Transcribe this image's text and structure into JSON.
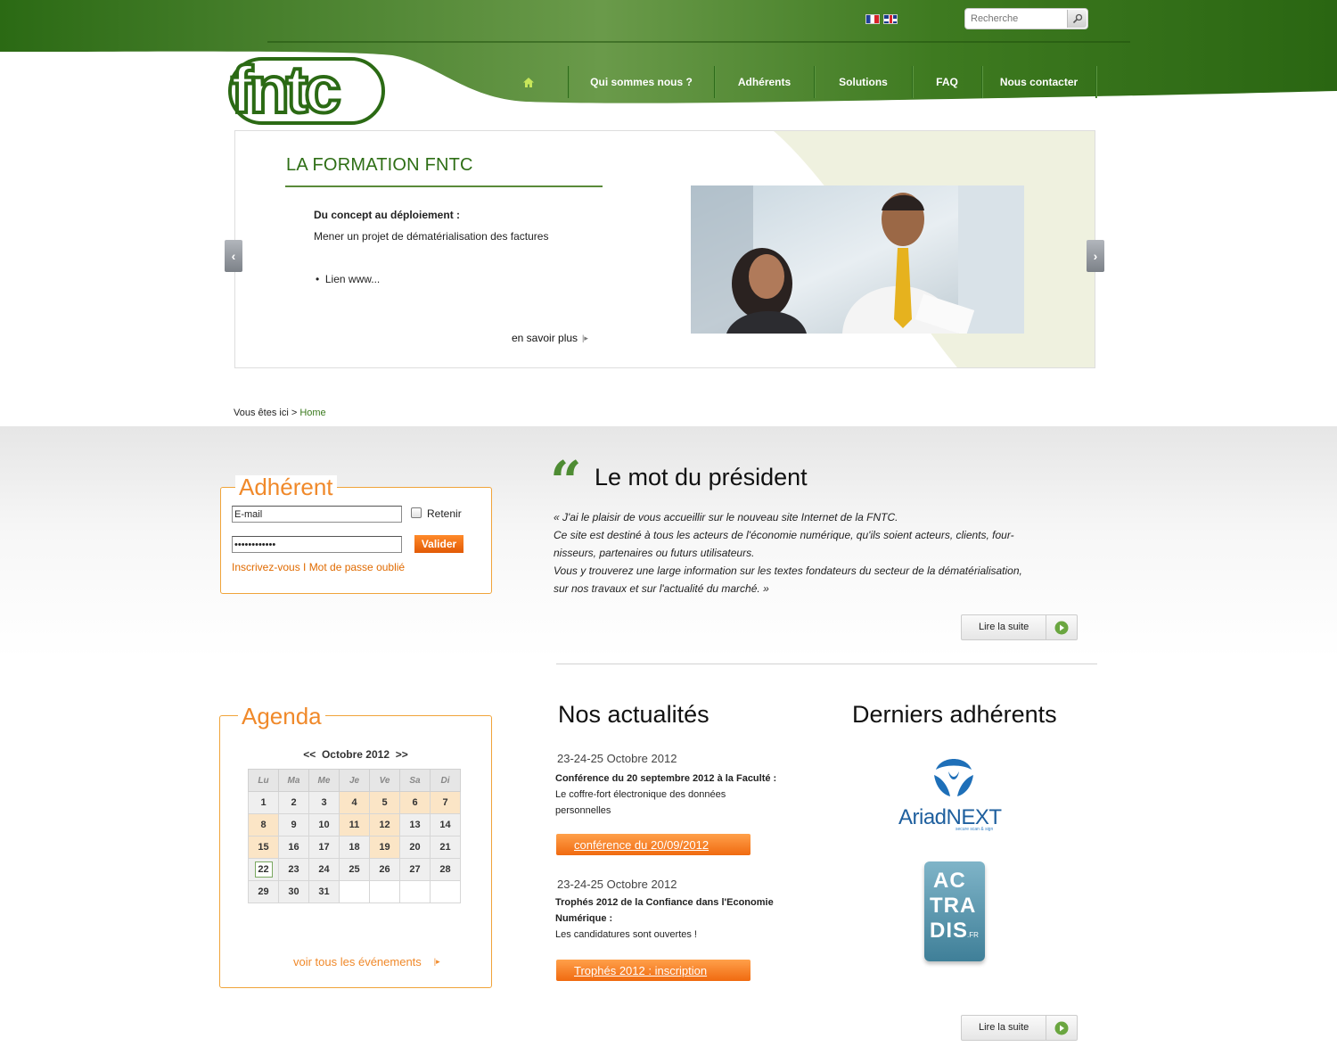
{
  "header": {
    "search": {
      "placeholder": "Recherche"
    },
    "logo_text": "fntc",
    "nav": [
      {
        "label": ""
      },
      {
        "label": "Qui sommes nous ?"
      },
      {
        "label": "Adhérents"
      },
      {
        "label": "Solutions"
      },
      {
        "label": "FAQ"
      },
      {
        "label": "Nous contacter"
      }
    ]
  },
  "slider": {
    "title": "LA FORMATION FNTC",
    "subtitle": "Du concept au déploiement :",
    "text": "Mener un projet de dématérialisation des factures",
    "bullet": "Lien www...",
    "more": "en savoir plus",
    "prev": "‹",
    "next": "›"
  },
  "breadcrumb": {
    "prefix": "Vous êtes ici >",
    "current": "Home"
  },
  "adherent": {
    "title": "Adhérent",
    "email_value": "E-mail",
    "password_value": "••••••••••••",
    "remember_label": "Retenir",
    "submit_label": "Valider",
    "links": "Inscrivez-vous I Mot de passe oublié"
  },
  "president": {
    "title": "Le mot du président",
    "paragraph": [
      "« J'ai le plaisir de vous accueillir sur le nouveau site Internet de la FNTC.",
      "Ce site est destiné à tous les acteurs de l'économie numérique, qu'ils soient acteurs, clients,  four-",
      "nisseurs, partenaires ou futurs utilisateurs.",
      "Vous y trouverez une large information sur les textes fondateurs du secteur de la dématérialisation,",
      "sur nos travaux et sur l'actualité du marché. »"
    ],
    "more_label": "Lire la suite"
  },
  "agenda": {
    "title": "Agenda",
    "prev": "<<",
    "month": "Octobre 2012",
    "next": ">>",
    "days": [
      "Lu",
      "Ma",
      "Me",
      "Je",
      "Ve",
      "Sa",
      "Di"
    ],
    "weeks": [
      [
        "1",
        "2",
        "3",
        "4",
        "5",
        "6",
        "7"
      ],
      [
        "8",
        "9",
        "10",
        "11",
        "12",
        "13",
        "14"
      ],
      [
        "15",
        "16",
        "17",
        "18",
        "19",
        "20",
        "21"
      ],
      [
        "22",
        "23",
        "24",
        "25",
        "26",
        "27",
        "28"
      ],
      [
        "29",
        "30",
        "31",
        "",
        "",
        "",
        ""
      ]
    ],
    "event_days": [
      "4",
      "5",
      "6",
      "7",
      "8",
      "11",
      "12",
      "15",
      "19"
    ],
    "today": "22",
    "more": "voir tous les événements"
  },
  "news": {
    "title": "Nos actualités",
    "items": [
      {
        "date": "23-24-25 Octobre 2012",
        "head": "Conférence du 20 septembre 2012 à la Faculté :",
        "body": "Le coffre-fort électronique des données personnelles",
        "button": "conférence du 20/09/2012"
      },
      {
        "date": "23-24-25 Octobre 2012",
        "head": "Trophés 2012 de la Confiance dans l'Economie Numérique :",
        "body": "Les candidatures sont ouvertes !",
        "button": "Trophés 2012 : inscription"
      }
    ]
  },
  "members": {
    "title": "Derniers adhérents",
    "ariadnext": {
      "name": "AriadNEXT",
      "tagline": "secure scan & sign"
    },
    "actradis": {
      "lines": [
        "AC",
        "TRA",
        "DIS"
      ],
      "suffix": ".FR"
    },
    "more_label": "Lire la suite"
  },
  "colors": {
    "brand_green": "#2e6e15",
    "accent_orange": "#f0892a"
  }
}
